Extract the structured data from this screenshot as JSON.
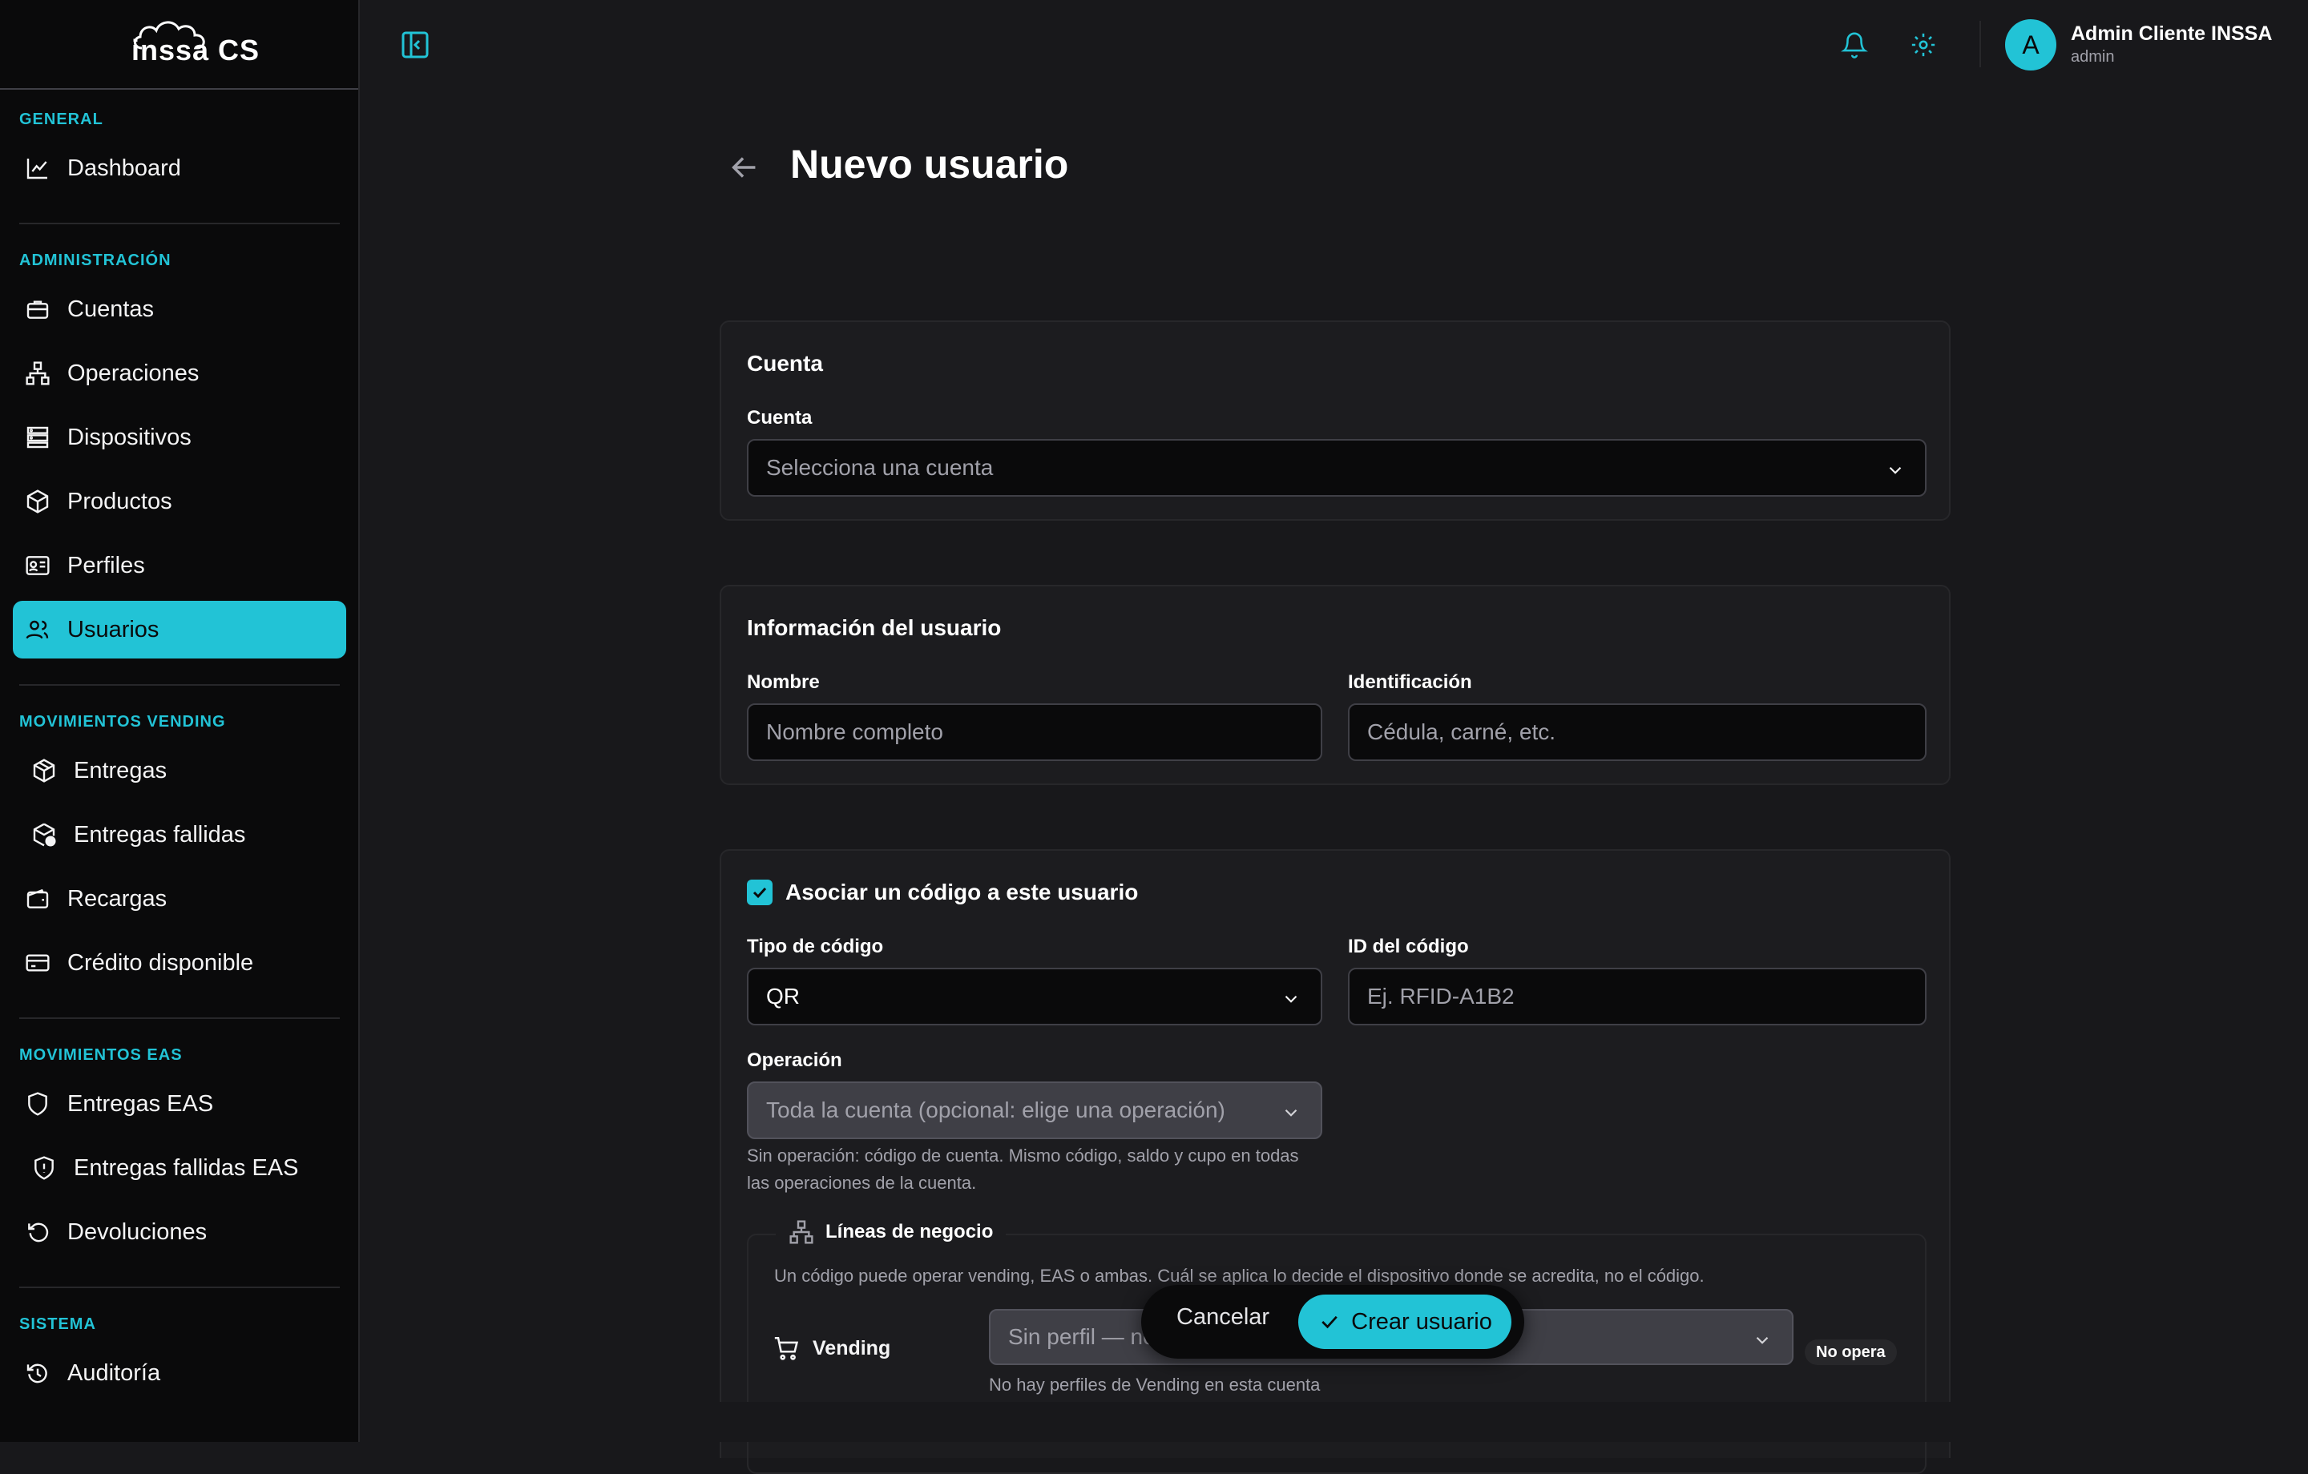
{
  "app": {
    "logo_text": "inssa CS"
  },
  "topbar": {
    "user_name": "Admin Cliente INSSA",
    "user_role": "admin",
    "avatar_initial": "A"
  },
  "sidebar": {
    "sections": {
      "general": "GENERAL",
      "admin": "ADMINISTRACIÓN",
      "vending": "MOVIMIENTOS VENDING",
      "eas": "MOVIMIENTOS EAS",
      "system": "SISTEMA"
    },
    "items": {
      "dashboard": "Dashboard",
      "cuentas": "Cuentas",
      "operaciones": "Operaciones",
      "dispositivos": "Dispositivos",
      "productos": "Productos",
      "perfiles": "Perfiles",
      "usuarios": "Usuarios",
      "entregas": "Entregas",
      "entregas_fallidas": "Entregas fallidas",
      "recargas": "Recargas",
      "credito": "Crédito disponible",
      "entregas_eas": "Entregas EAS",
      "entregas_fallidas_eas": "Entregas fallidas EAS",
      "devoluciones": "Devoluciones",
      "auditoria": "Auditoría"
    },
    "active": "usuarios"
  },
  "page": {
    "title": "Nuevo usuario"
  },
  "cuenta_card": {
    "title": "Cuenta",
    "label": "Cuenta",
    "placeholder": "Selecciona una cuenta"
  },
  "info_card": {
    "title": "Información del usuario",
    "nombre_label": "Nombre",
    "nombre_placeholder": "Nombre completo",
    "id_label": "Identificación",
    "id_placeholder": "Cédula, carné, etc."
  },
  "codigo_card": {
    "checkbox_label": "Asociar un código a este usuario",
    "checked": true,
    "tipo_label": "Tipo de código",
    "tipo_value": "QR",
    "id_label": "ID del código",
    "id_placeholder": "Ej. RFID-A1B2",
    "operacion_label": "Operación",
    "operacion_value": "Toda la cuenta (opcional: elige una operación)",
    "operacion_help_1": "Sin operación: código de cuenta. Mismo código, saldo y cupo en todas",
    "operacion_help_2": "las operaciones de la cuenta.",
    "lineas_title": "Líneas de negocio",
    "lineas_help": "Un código puede operar vending, EAS o ambas. Cuál se aplica lo decide el dispositivo donde se acredita, no el código.",
    "vending_label": "Vending",
    "vending_select": "Sin perfil — no",
    "vending_help": "No hay perfiles de Vending en esta cuenta",
    "vending_badge": "No opera"
  },
  "actions": {
    "cancel": "Cancelar",
    "create": "Crear usuario"
  },
  "colors": {
    "accent": "#22c3d6",
    "background": "#18181b",
    "sidebar": "#0a0a0b"
  }
}
